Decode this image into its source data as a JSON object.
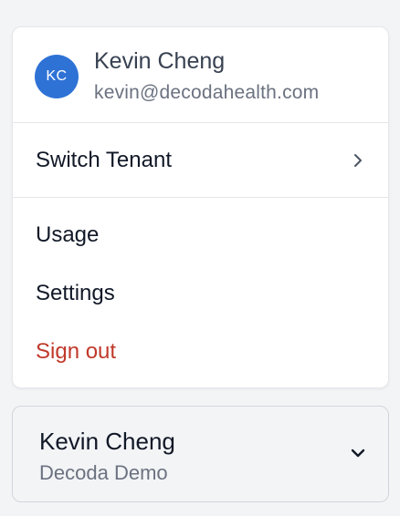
{
  "profile": {
    "initials": "KC",
    "name": "Kevin Cheng",
    "email": "kevin@decodahealth.com",
    "avatar_color": "#2f72d6"
  },
  "menu": {
    "switch_tenant": "Switch Tenant",
    "items": [
      {
        "label": "Usage"
      },
      {
        "label": "Settings"
      },
      {
        "label": "Sign out",
        "color": "#c0392b"
      }
    ]
  },
  "account_card": {
    "name": "Kevin Cheng",
    "tenant": "Decoda Demo"
  },
  "icons": {
    "submenu": "chevron-right-icon",
    "expand": "chevron-down-icon"
  }
}
